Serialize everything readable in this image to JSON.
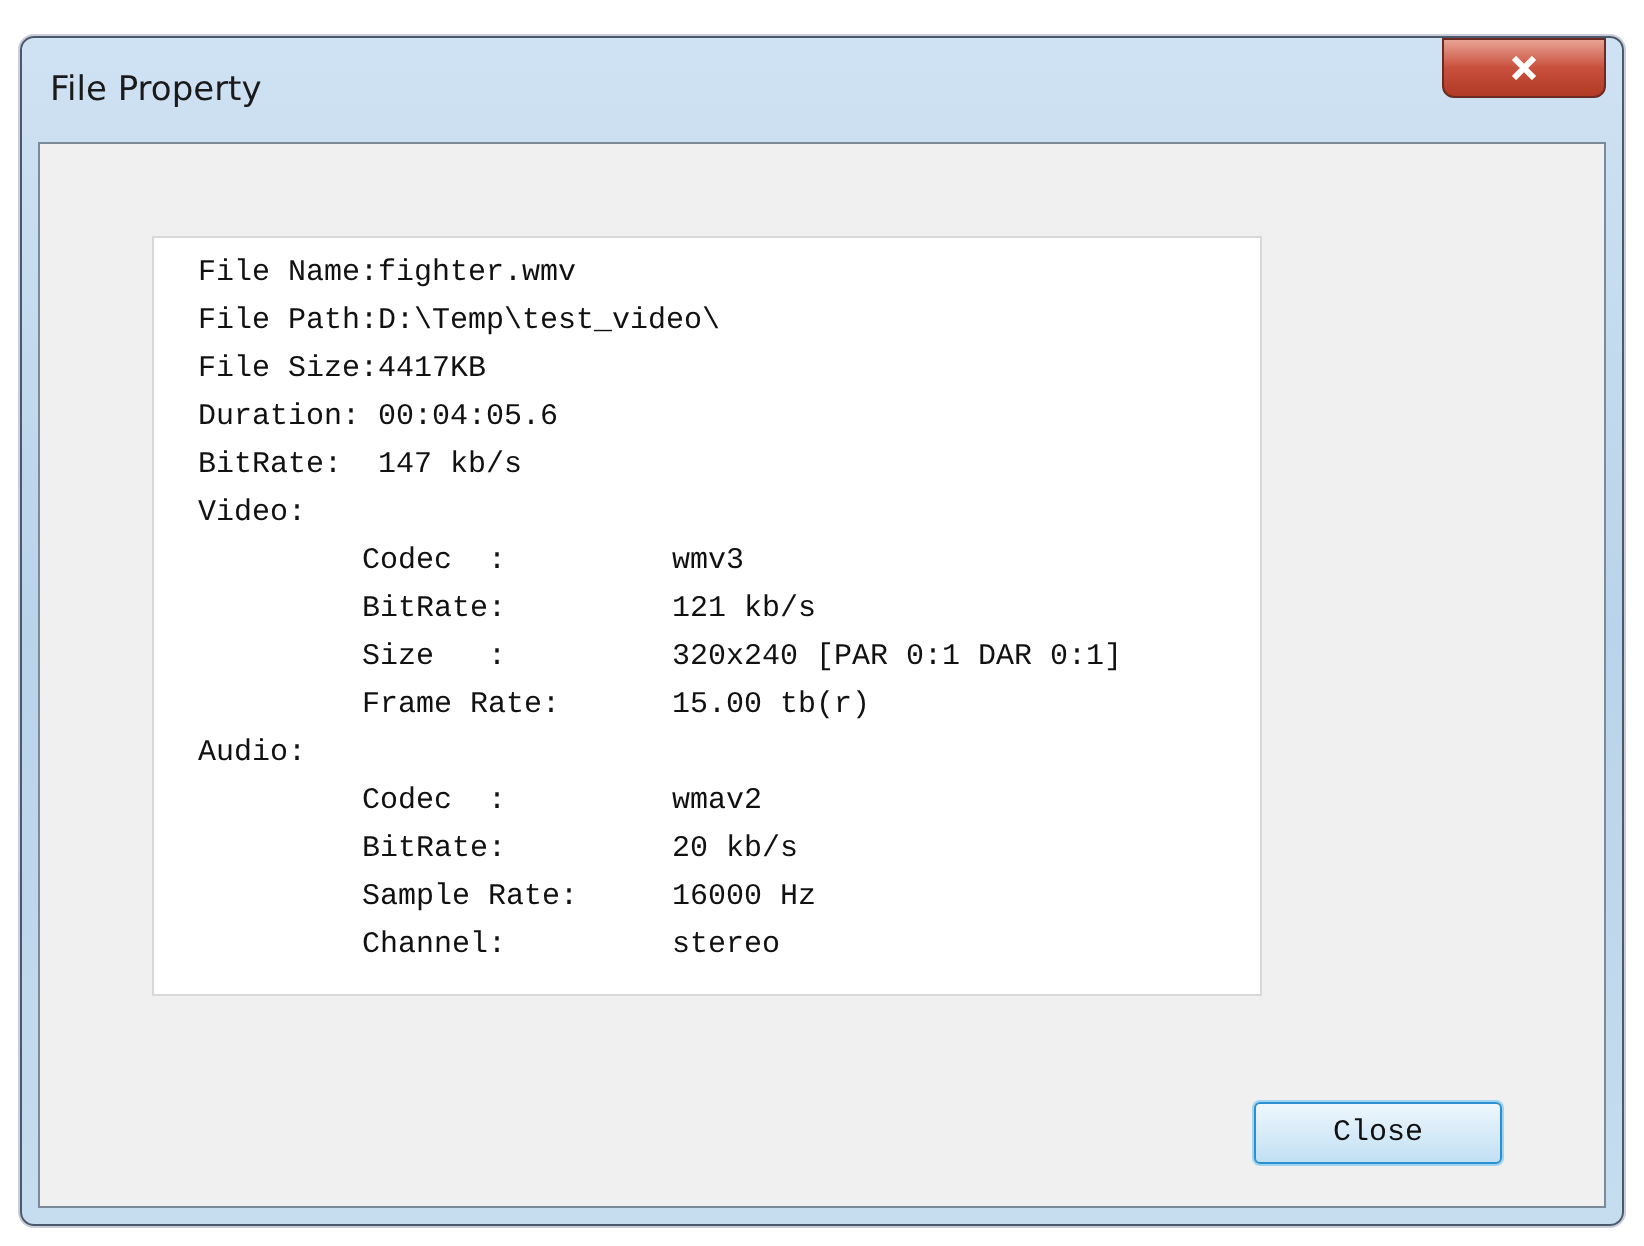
{
  "window": {
    "title": "File Property"
  },
  "info": {
    "lines": [
      "File Name:fighter.wmv",
      "File Path:D:\\Temp\\test_video\\",
      "File Size:4417KB",
      "Duration: 00:04:05.6",
      "BitRate:  147 kb/s"
    ],
    "sections": [
      {
        "title": "Video:",
        "fields": [
          {
            "label": "Codec  :",
            "value": "wmv3"
          },
          {
            "label": "BitRate:",
            "value": "121 kb/s"
          },
          {
            "label": "Size   :",
            "value": "320x240 [PAR 0:1 DAR 0:1]"
          },
          {
            "label": "Frame Rate:",
            "value": "15.00 tb(r)"
          }
        ]
      },
      {
        "title": "Audio:",
        "fields": [
          {
            "label": "Codec  :",
            "value": "wmav2"
          },
          {
            "label": "BitRate:",
            "value": "20 kb/s"
          },
          {
            "label": "Sample Rate:",
            "value": "16000 Hz"
          },
          {
            "label": "Channel:",
            "value": "stereo"
          }
        ]
      }
    ]
  },
  "buttons": [
    "Close"
  ]
}
